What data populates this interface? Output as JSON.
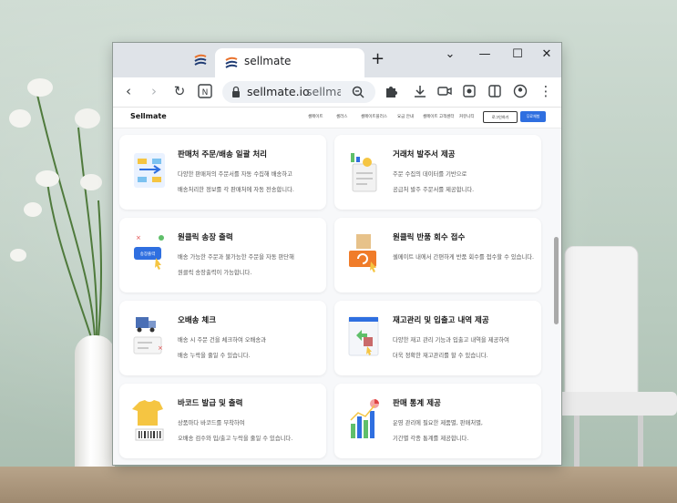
{
  "browser": {
    "tab_title": "sellmate",
    "tab_close": "×",
    "new_tab": "+",
    "window_controls": [
      "⌄",
      "—",
      "☐",
      "✕"
    ],
    "url_host": "sellmate.io",
    "url_path": "sellmate"
  },
  "site": {
    "logo": "Sellmate",
    "nav": [
      "셀메이트",
      "셀러스",
      "셀메이트플러스",
      "요금 안내",
      "셀메이트 고객센터",
      "커뮤니티"
    ],
    "btn_login": "로그인하기",
    "btn_signup": "무료체험"
  },
  "cards": [
    {
      "title": "판매처 주문/배송 일괄 처리",
      "line1": "다양한 판매처의 주문서를 자동 수집해 배송하고",
      "line2": "배송처리한 정보를 각 판매처에 자동 전송합니다."
    },
    {
      "title": "거래처 발주서 제공",
      "line1": "주문 수집의 데이터를 기반으로",
      "line2": "공급처 발주 주문서를 제공합니다."
    },
    {
      "title": "원클릭 송장 출력",
      "line1": "배송 가능한 주문과 불가능한 주문을 자동 판단해",
      "line2": "원클릭 송장출력이 가능합니다.",
      "badge": "송장출력"
    },
    {
      "title": "원클릭 반품 회수 접수",
      "line1": "셀메이트 내에서 간편하게 반품 회수를 접수할 수 있습니다.",
      "line2": ""
    },
    {
      "title": "오배송 체크",
      "line1": "배송 시 주문 건을 체크하여 오배송과",
      "line2": "배송 누락을 줄일 수 있습니다."
    },
    {
      "title": "재고관리 및 입출고 내역 제공",
      "line1": "다양한 재고 관리 기능과 입출고 내역을 제공하여",
      "line2": "더욱 정확한 재고관리를 할 수 있습니다."
    },
    {
      "title": "바코드 발급 및 출력",
      "line1": "상품마다 바코드를 부착하여",
      "line2": "오배송 검수와 입/출고 누락을 줄일 수 있습니다."
    },
    {
      "title": "판매 통계 제공",
      "line1": "운영 관리에 필요한 제품별, 판매처별,",
      "line2": "기간별 각종 통계를 제공합니다."
    }
  ],
  "colors": {
    "accent": "#2f6fe0",
    "tab_strip": "#dfe3e8",
    "page_bg": "#f7f8fa"
  }
}
